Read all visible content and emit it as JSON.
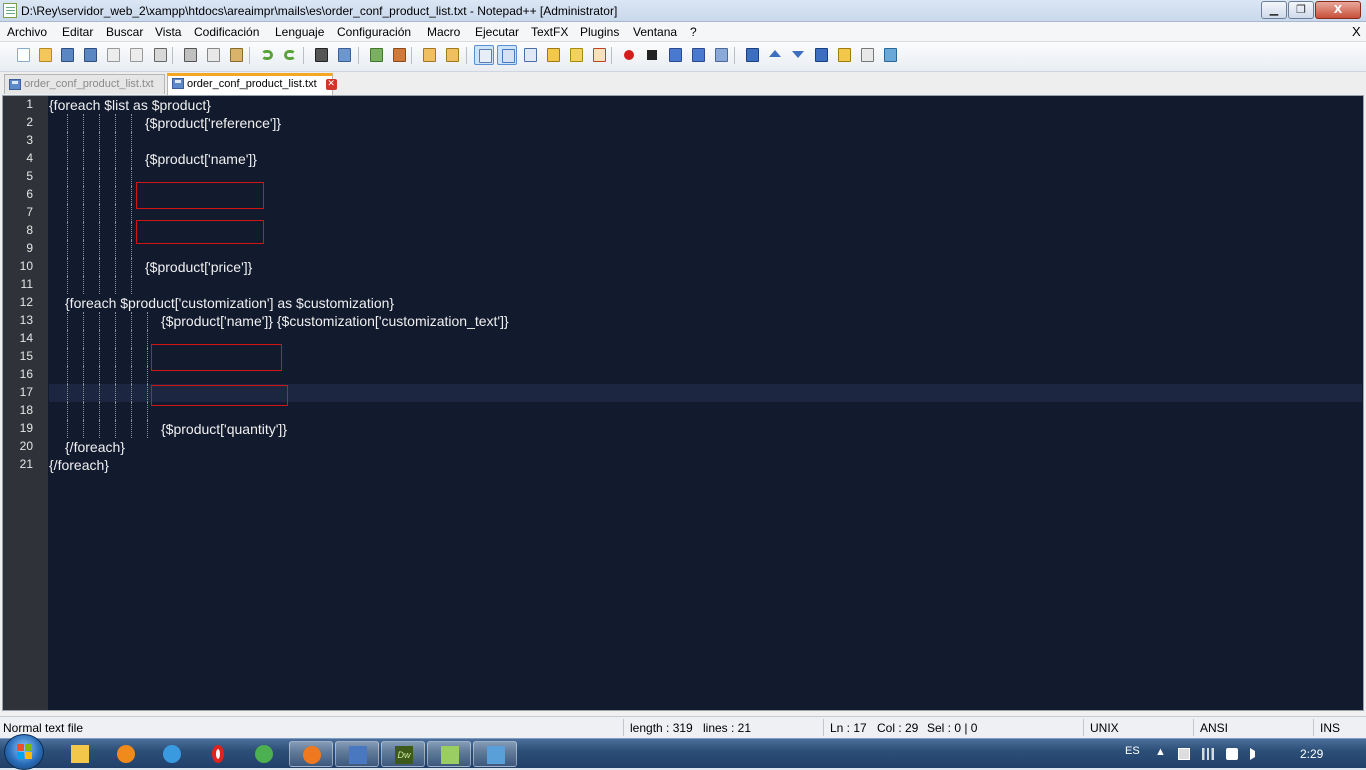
{
  "window": {
    "title": "D:\\Rey\\servidor_web_2\\xampp\\htdocs\\areaimpr\\mails\\es\\order_conf_product_list.txt - Notepad++ [Administrator]",
    "min_label": "▁",
    "max_label": "❐",
    "close_label": "X"
  },
  "menu": {
    "items": [
      "Archivo",
      "Editar",
      "Buscar",
      "Vista",
      "Codificación",
      "Lenguaje",
      "Configuración",
      "Macro",
      "Ejecutar",
      "TextFX",
      "Plugins",
      "Ventana",
      "?"
    ],
    "close": "X"
  },
  "toolbar": {
    "icons": [
      "new-file-icon",
      "open-file-icon",
      "save-icon",
      "save-all-icon",
      "close-icon",
      "close-all-icon",
      "print-icon",
      "cut-icon",
      "copy-icon",
      "paste-icon",
      "undo-icon",
      "redo-icon",
      "find-icon",
      "replace-icon",
      "zoom-in-icon",
      "zoom-out-icon",
      "sync-vertical-icon",
      "sync-horizontal-icon",
      "word-wrap-icon",
      "show-all-chars-icon",
      "indent-guide-icon",
      "user-defined-language-icon",
      "document-map-icon",
      "function-list-icon",
      "record-macro-icon",
      "stop-macro-icon",
      "play-macro-icon",
      "run-macro-multiple-icon",
      "save-macro-icon",
      "collapse-icon",
      "up-arrow-icon",
      "down-arrow-icon",
      "expand-icon",
      "folder-icon",
      "spell-check-icon",
      "abc-check-icon"
    ]
  },
  "tabs": [
    {
      "label": "order_conf_product_list.txt",
      "active": false
    },
    {
      "label": "order_conf_product_list.txt",
      "active": true
    }
  ],
  "editor": {
    "current_line": 17,
    "lines": [
      {
        "n": "1",
        "text": "{foreach $list as $product}"
      },
      {
        "n": "2",
        "text": "{$product['reference']}"
      },
      {
        "n": "3",
        "text": ""
      },
      {
        "n": "4",
        "text": "{$product['name']}"
      },
      {
        "n": "5",
        "text": ""
      },
      {
        "n": "6",
        "text": ""
      },
      {
        "n": "7",
        "text": ""
      },
      {
        "n": "8",
        "text": ""
      },
      {
        "n": "9",
        "text": ""
      },
      {
        "n": "10",
        "text": "{$product['price']}"
      },
      {
        "n": "11",
        "text": ""
      },
      {
        "n": "12",
        "text": "{foreach $product['customization'] as $customization}"
      },
      {
        "n": "13",
        "text": "{$product['name']} {$customization['customization_text']}"
      },
      {
        "n": "14",
        "text": ""
      },
      {
        "n": "15",
        "text": ""
      },
      {
        "n": "16",
        "text": ""
      },
      {
        "n": "17",
        "text": ""
      },
      {
        "n": "18",
        "text": ""
      },
      {
        "n": "19",
        "text": "{$product['quantity']}"
      },
      {
        "n": "20",
        "text": "{/foreach}"
      },
      {
        "n": "21",
        "text": "{/foreach}"
      }
    ]
  },
  "statusbar": {
    "type": "Normal text file",
    "length": "length : 319",
    "lines": "lines : 21",
    "ln": "Ln : 17",
    "col": "Col : 29",
    "sel": "Sel : 0 | 0",
    "eol": "UNIX",
    "encoding": "ANSI",
    "mode": "INS"
  },
  "taskbar": {
    "apps": [
      "explorer-icon",
      "avast-icon",
      "internet-explorer-icon",
      "opera-icon",
      "chrome-icon",
      "firefox-icon",
      "floppy-save-icon",
      "dreamweaver-icon",
      "notepadpp-icon",
      "image-viewer-icon"
    ],
    "dreamweaver_label": "Dw",
    "lang": "ES",
    "time": "2:29"
  }
}
